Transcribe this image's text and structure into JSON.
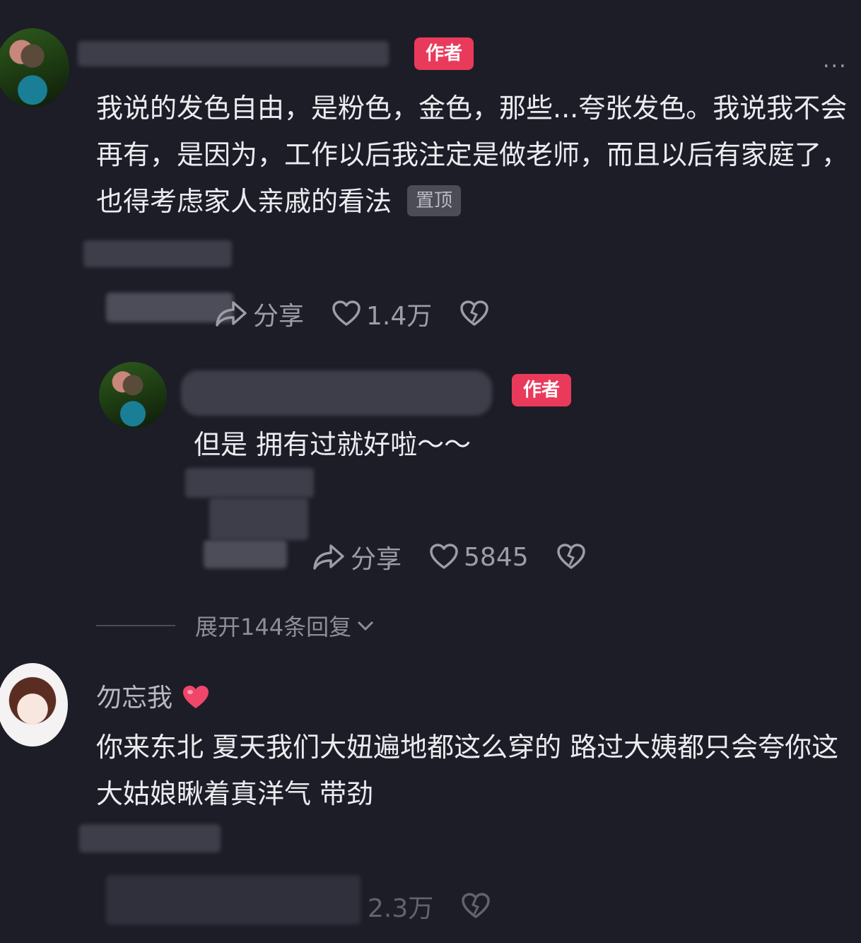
{
  "comment1": {
    "badge": "作者",
    "more_label": "...",
    "text": "我说的发色自由，是粉色，金色，那些...夸张发色。我说我不会再有，是因为，工作以后我注定是做老师，而且以后有家庭了，也得考虑家人亲戚的看法",
    "pin_label": "置顶",
    "share_label": "分享",
    "likes": "1.4万"
  },
  "reply1": {
    "badge": "作者",
    "text": "但是 拥有过就好啦～～",
    "share_label": "分享",
    "likes": "5845"
  },
  "expand_label": "展开144条回复",
  "comment2": {
    "username": "勿忘我",
    "text": "你来东北 夏天我们大妞遍地都这么穿的 路过大姨都只会夸你这大姑娘瞅着真洋气 带劲",
    "likes": "2.3万"
  },
  "colors": {
    "background": "#1c1d27",
    "badge": "#ea3a5b",
    "heart_emoji": "#f0466a"
  }
}
